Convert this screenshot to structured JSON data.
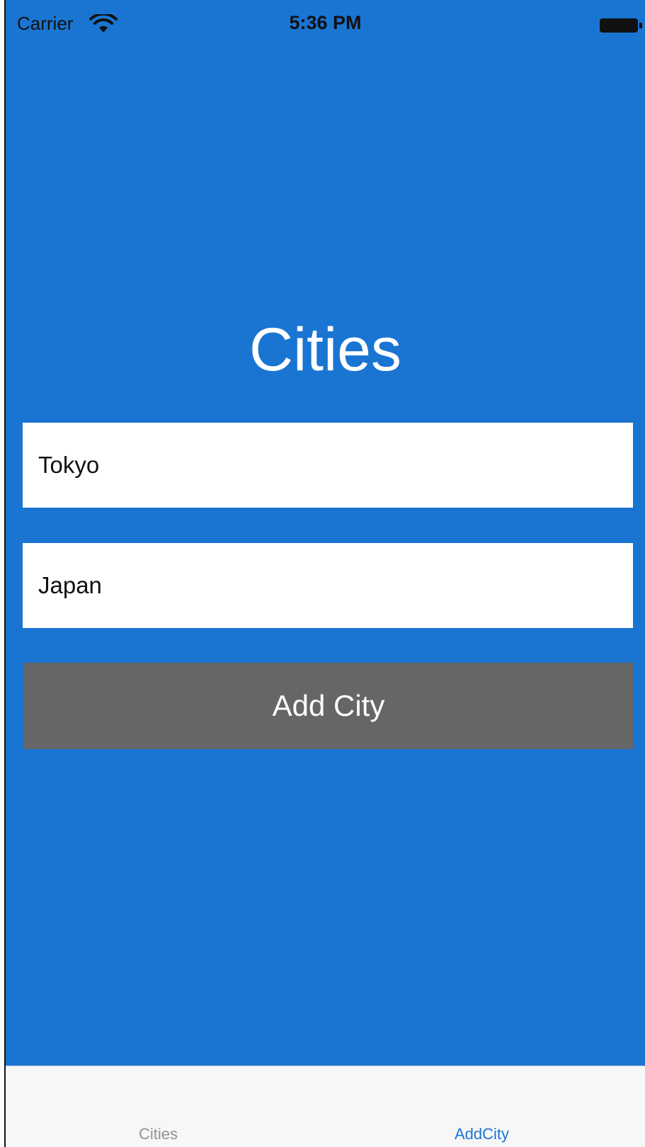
{
  "status_bar": {
    "carrier": "Carrier",
    "time": "5:36 PM",
    "wifi_icon": "wifi-icon",
    "battery_icon": "battery-icon"
  },
  "main": {
    "title": "Cities",
    "city_field": {
      "value": "Tokyo",
      "placeholder": ""
    },
    "country_field": {
      "value": "Japan",
      "placeholder": ""
    },
    "add_button_label": "Add City"
  },
  "tab_bar": {
    "tabs": [
      {
        "label": "Cities",
        "selected": false
      },
      {
        "label": "AddCity",
        "selected": true
      }
    ]
  },
  "colors": {
    "background": "#1a75d2",
    "button": "#666666",
    "tab_active": "#1a75d2",
    "tab_inactive": "#929292",
    "tab_bar_bg": "#f7f7f7"
  }
}
